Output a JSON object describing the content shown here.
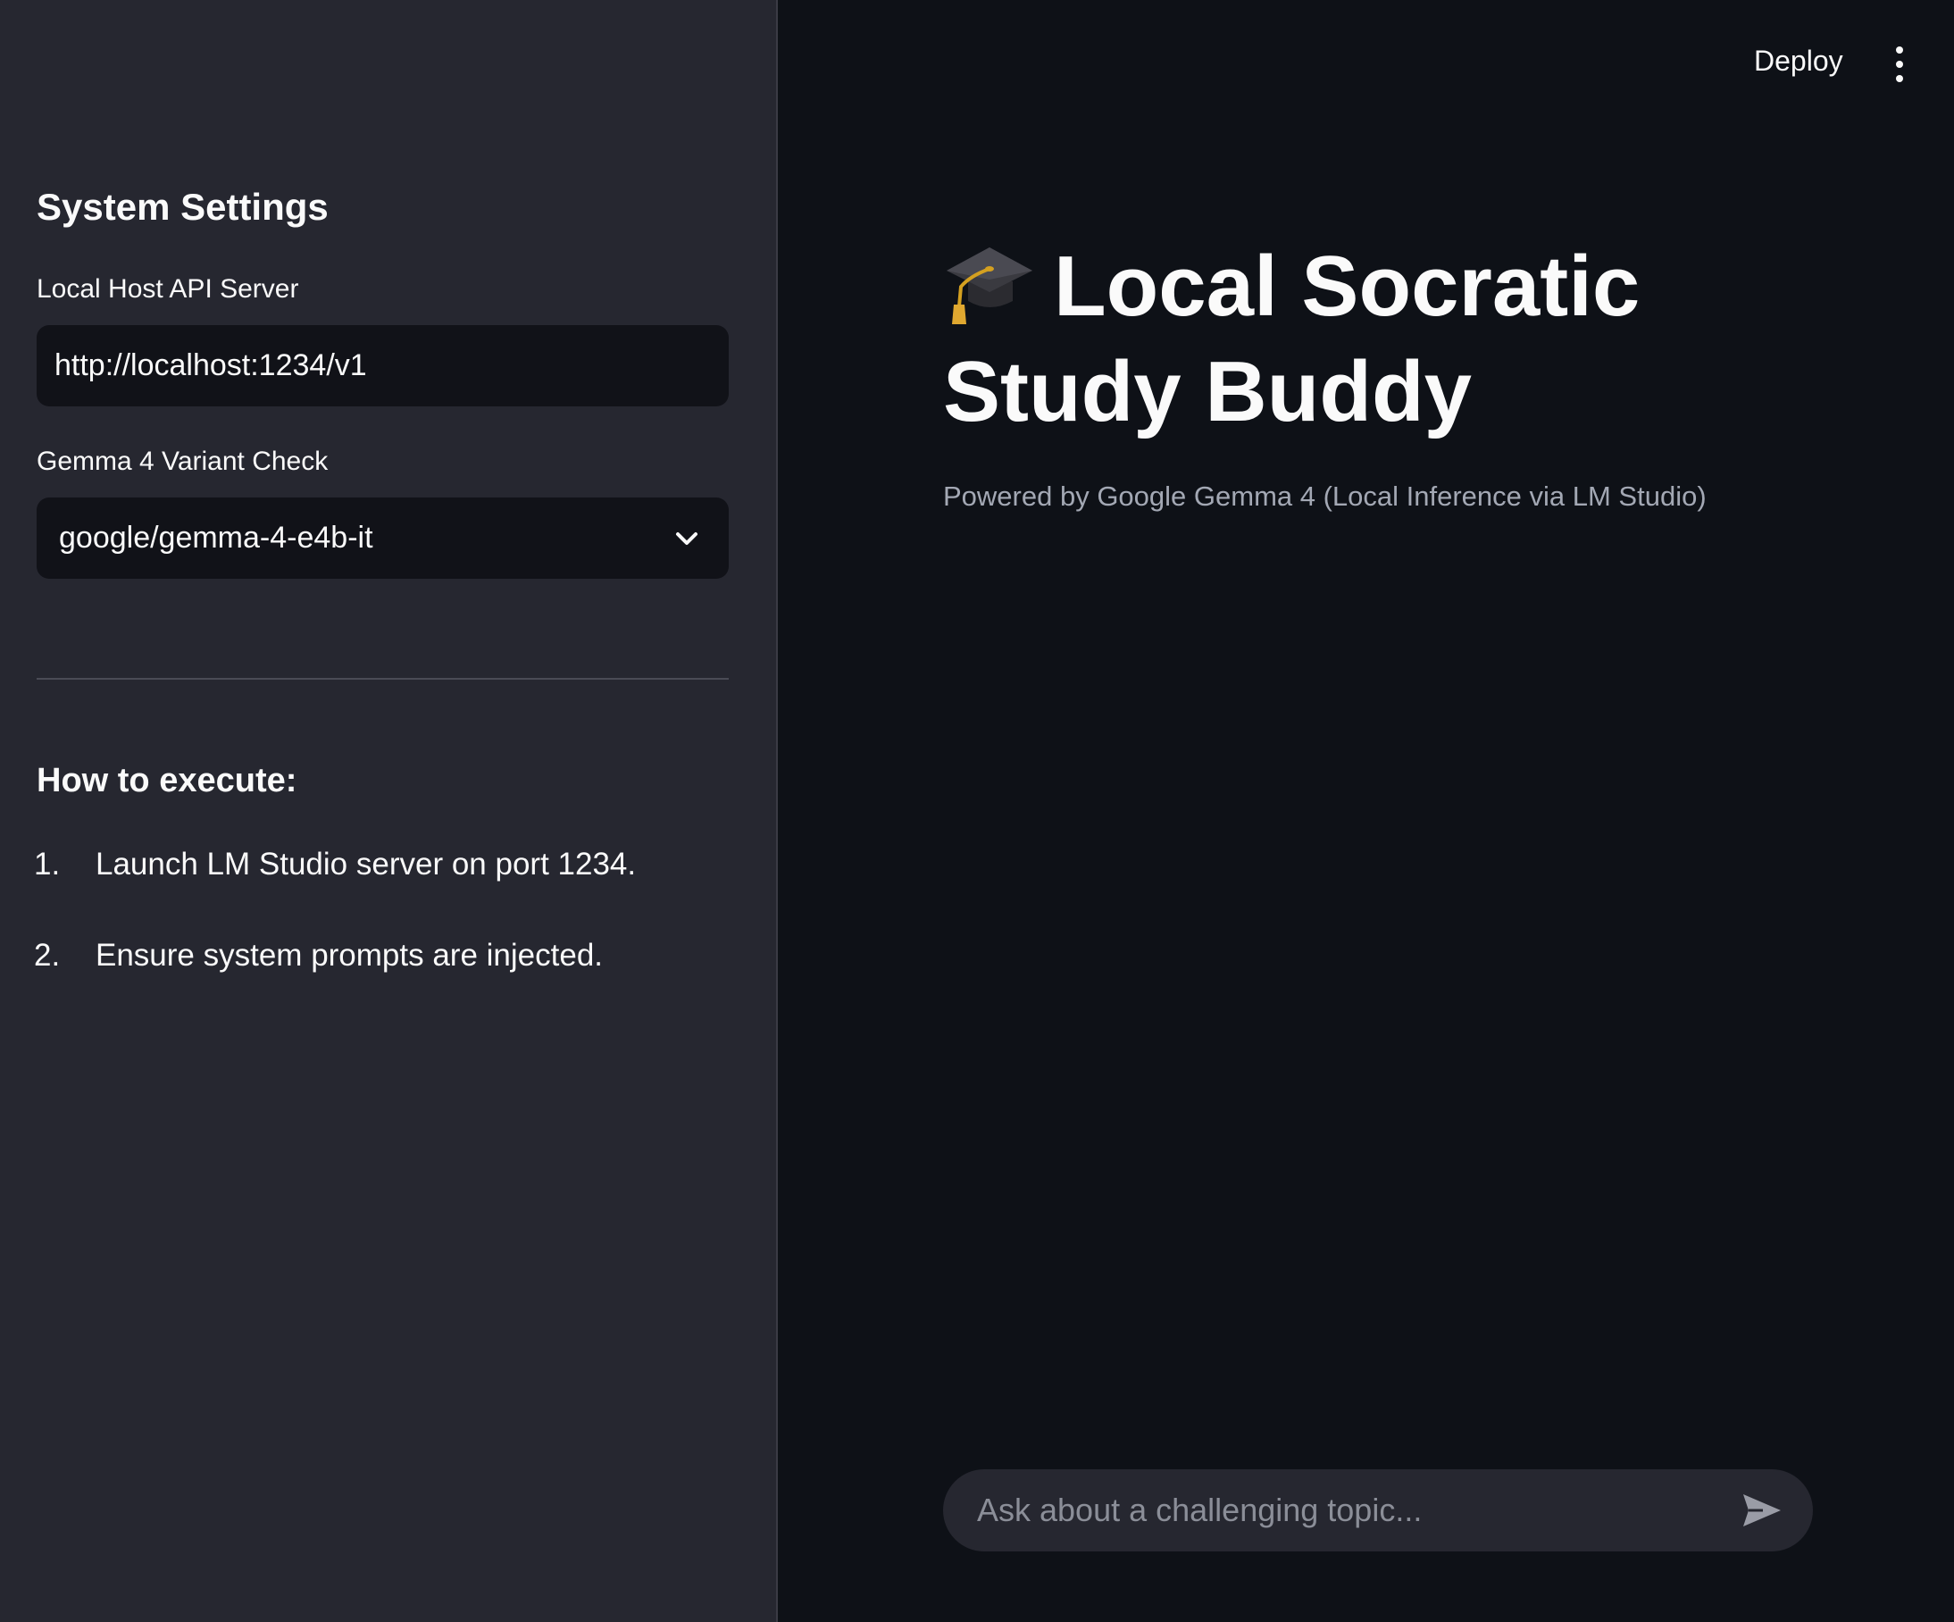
{
  "sidebar": {
    "heading": "System Settings",
    "api_server": {
      "label": "Local Host API Server",
      "value": "http://localhost:1234/v1"
    },
    "variant": {
      "label": "Gemma 4 Variant Check",
      "selected": "google/gemma-4-e4b-it"
    },
    "howto": {
      "heading": "How to execute:",
      "steps": [
        {
          "num": "1.",
          "text": "Launch LM Studio server on port 1234."
        },
        {
          "num": "2.",
          "text": "Ensure system prompts are injected."
        }
      ]
    }
  },
  "header": {
    "deploy_label": "Deploy",
    "menu_icon": "kebab-menu-icon"
  },
  "main": {
    "title_icon": "graduation-cap-icon",
    "title": "Local Socratic Study Buddy",
    "subtitle": "Powered by Google Gemma 4 (Local Inference via LM Studio)"
  },
  "chat": {
    "placeholder": "Ask about a challenging topic...",
    "send_icon": "send-icon"
  },
  "colors": {
    "sidebar_bg": "#262730",
    "main_bg": "#0e1117",
    "input_bg": "#111218",
    "text": "#fafafa",
    "muted_text": "#a3a8b4"
  }
}
